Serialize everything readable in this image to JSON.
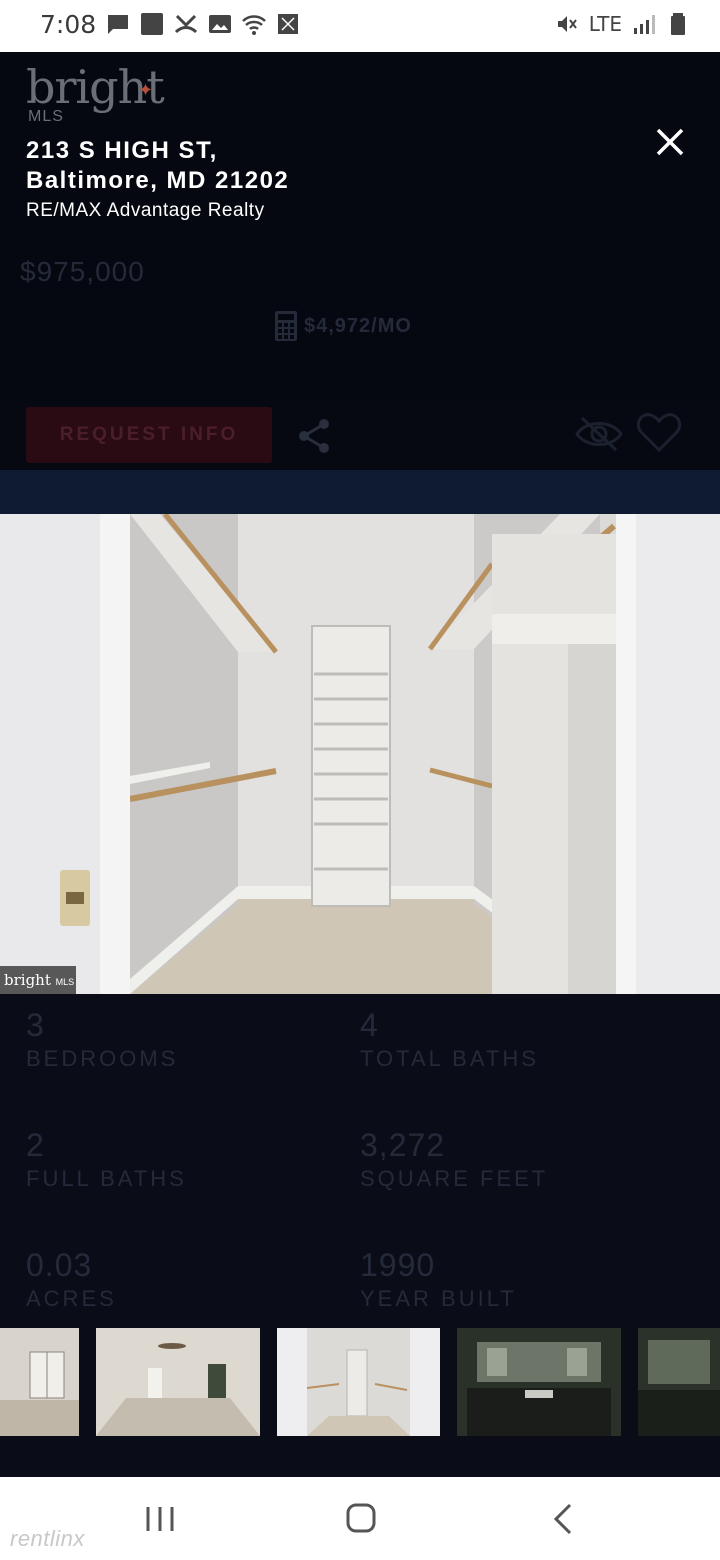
{
  "status_bar": {
    "time": "7:08",
    "network": "LTE",
    "icons": [
      "message-icon",
      "app-icon",
      "missed-call-icon",
      "image-icon",
      "wifi-icon",
      "nfc-icon",
      "mute-icon",
      "signal-icon",
      "battery-icon"
    ]
  },
  "brand": {
    "logo_text": "bright",
    "logo_sub": "MLS"
  },
  "listing": {
    "address_line1": "213 S HIGH ST,",
    "address_line2": "Baltimore, MD 21202",
    "broker": "RE/MAX Advantage Realty",
    "price": "$975,000",
    "monthly": "$4,972/MO"
  },
  "actions": {
    "request_info": "REQUEST INFO"
  },
  "photo": {
    "watermark": "bright",
    "watermark_sub": "MLS",
    "subject": "walk-in closet"
  },
  "stats": [
    {
      "value": "3",
      "label": "BEDROOMS"
    },
    {
      "value": "4",
      "label": "TOTAL BATHS"
    },
    {
      "value": "2",
      "label": "FULL BATHS"
    },
    {
      "value": "3,272",
      "label": "SQUARE FEET"
    },
    {
      "value": "0.03",
      "label": "ACRES"
    },
    {
      "value": "1990",
      "label": "YEAR BUILT"
    }
  ],
  "thumbnails": [
    "living-room-thumbnail",
    "bedroom-thumbnail",
    "closet-thumbnail",
    "bathroom-thumbnail",
    "bathroom-2-thumbnail"
  ],
  "footer": {
    "watermark": "rentlinx"
  },
  "colors": {
    "background": "#0a0d17",
    "accent": "#b5523a",
    "request_button": "#2a0b14"
  }
}
